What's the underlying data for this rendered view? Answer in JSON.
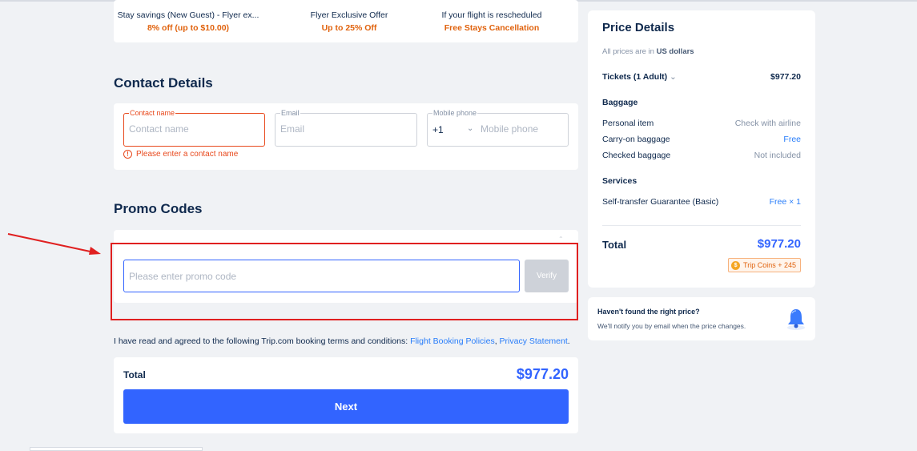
{
  "perks": [
    {
      "title": "Stay savings (New Guest) - Flyer ex...",
      "subtitle": "8% off (up to $10.00)"
    },
    {
      "title": "Flyer Exclusive Offer",
      "subtitle": "Up to 25% Off"
    },
    {
      "title": "If your flight is rescheduled",
      "subtitle": "Free Stays Cancellation"
    }
  ],
  "contact": {
    "title": "Contact Details",
    "name_label": "Contact name",
    "name_placeholder": "Contact name",
    "email_label": "Email",
    "email_placeholder": "Email",
    "phone_label": "Mobile phone",
    "phone_code": "+1",
    "phone_placeholder": "Mobile phone",
    "error": "Please enter a contact name"
  },
  "promo": {
    "title": "Promo Codes",
    "placeholder": "Please enter promo code",
    "verify_label": "Verify"
  },
  "terms": {
    "text": "I have read and agreed to the following Trip.com booking terms and conditions: ",
    "link1": "Flight Booking Policies",
    "sep": ", ",
    "link2": "Privacy Statement",
    "end": "."
  },
  "footer": {
    "total_label": "Total",
    "total_value": "$977.20",
    "next_label": "Next"
  },
  "price_details": {
    "title": "Price Details",
    "currency_prefix": "All prices are in ",
    "currency": "US dollars",
    "tickets_label": "Tickets (1 Adult)",
    "tickets_value": "$977.20",
    "baggage_heading": "Baggage",
    "baggage": [
      {
        "label": "Personal item",
        "value": "Check with airline"
      },
      {
        "label": "Carry-on baggage",
        "value": "Free"
      },
      {
        "label": "Checked baggage",
        "value": "Not included"
      }
    ],
    "services_heading": "Services",
    "service_label": "Self-transfer Guarantee (Basic)",
    "service_value": "Free × 1",
    "total_label": "Total",
    "total_value": "$977.20",
    "coins": "Trip Coins + 245"
  },
  "notify": {
    "title": "Haven't found the right price?",
    "subtitle": "We'll notify you by email when the price changes."
  },
  "colors": {
    "accent": "#3264ff",
    "error": "#e8491d",
    "perk": "#e0620d",
    "highlight_box": "#e02020"
  }
}
